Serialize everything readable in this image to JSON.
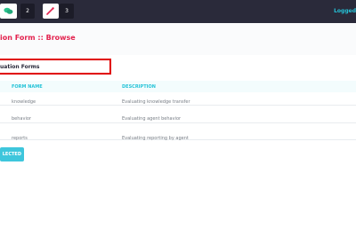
{
  "topbar": {
    "badges": [
      {
        "icon": "chat-bubbles-icon",
        "count": "2",
        "color": "#2bc48f"
      },
      {
        "icon": "magic-wand-icon",
        "count": "3",
        "color": "#e3224e"
      }
    ],
    "user_label": "Logged"
  },
  "page": {
    "title": "ion Form :: Browse"
  },
  "section": {
    "title": "uation Forms"
  },
  "table": {
    "columns": [
      "FORM NAME",
      "DESCRIPTION"
    ],
    "rows": [
      {
        "name": "knowledge",
        "description": "Evaluating knowledge transfer"
      },
      {
        "name": "behavior",
        "description": "Evaluating agent behavior"
      },
      {
        "name": "reports",
        "description": "Evaluating reporting by agent"
      }
    ]
  },
  "actions": {
    "delete_selected_label": "LECTED"
  },
  "colors": {
    "accent": "#25c3d8",
    "title": "#e3224e",
    "highlight": "#e00000",
    "topbar": "#2a2a3a"
  }
}
